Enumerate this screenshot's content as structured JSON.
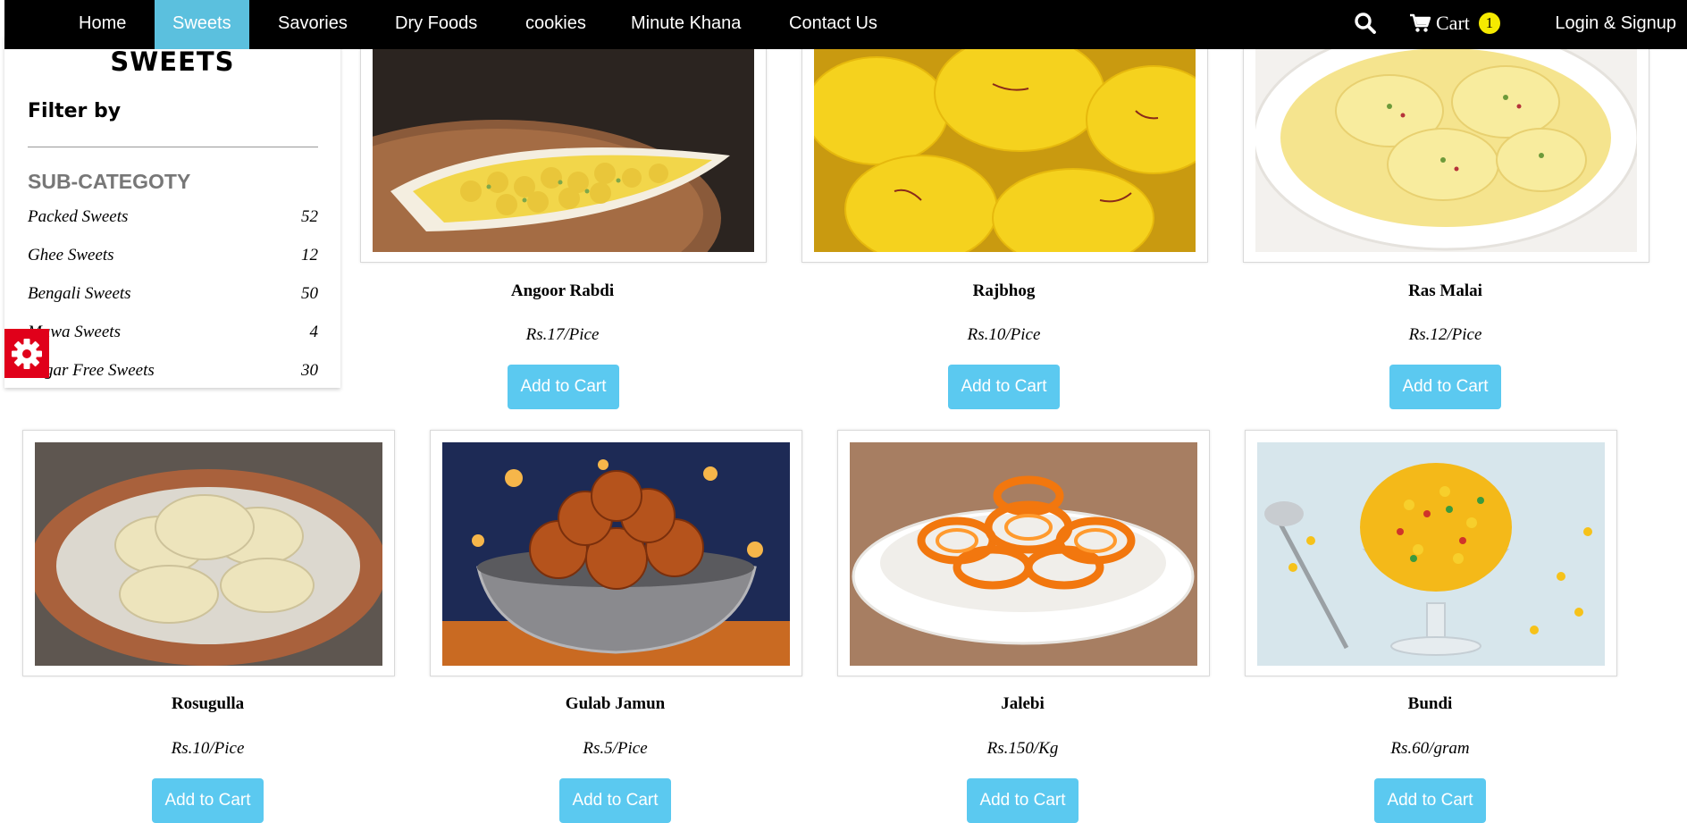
{
  "nav": {
    "items": [
      "Home",
      "Sweets",
      "Savories",
      "Dry Foods",
      "cookies",
      "Minute Khana",
      "Contact Us"
    ],
    "active": "Sweets",
    "cart_label": "Cart",
    "cart_count": "1",
    "login_label": "Login & Signup"
  },
  "sidebar": {
    "heading": "SWEETS",
    "filter_label": "Filter by",
    "subcategory_title": "SUB-CATEGOTY",
    "categories": [
      {
        "name": "Packed Sweets",
        "count": "52"
      },
      {
        "name": "Ghee Sweets",
        "count": "12"
      },
      {
        "name": "Bengali Sweets",
        "count": "50"
      },
      {
        "name": "Mawa Sweets",
        "count": "4"
      },
      {
        "name": "Sugar Free Sweets",
        "count": "30"
      }
    ]
  },
  "products": [
    {
      "name": "Angoor Rabdi",
      "price": "Rs.17/Pice",
      "button": "Add to Cart"
    },
    {
      "name": "Rajbhog",
      "price": "Rs.10/Pice",
      "button": "Add to Cart"
    },
    {
      "name": "Ras Malai",
      "price": "Rs.12/Pice",
      "button": "Add to Cart"
    },
    {
      "name": "Rosugulla",
      "price": "Rs.10/Pice",
      "button": "Add to Cart"
    },
    {
      "name": "Gulab Jamun",
      "price": "Rs.5/Pice",
      "button": "Add to Cart"
    },
    {
      "name": "Jalebi",
      "price": "Rs.150/Kg",
      "button": "Add to Cart"
    },
    {
      "name": "Bundi",
      "price": "Rs.60/gram",
      "button": "Add to Cart"
    }
  ],
  "colors": {
    "nav_bg": "#000000",
    "active_tab": "#5bc0de",
    "button": "#5bc9f0",
    "badge": "#f5ea00",
    "gear_tab": "#e0001a"
  }
}
